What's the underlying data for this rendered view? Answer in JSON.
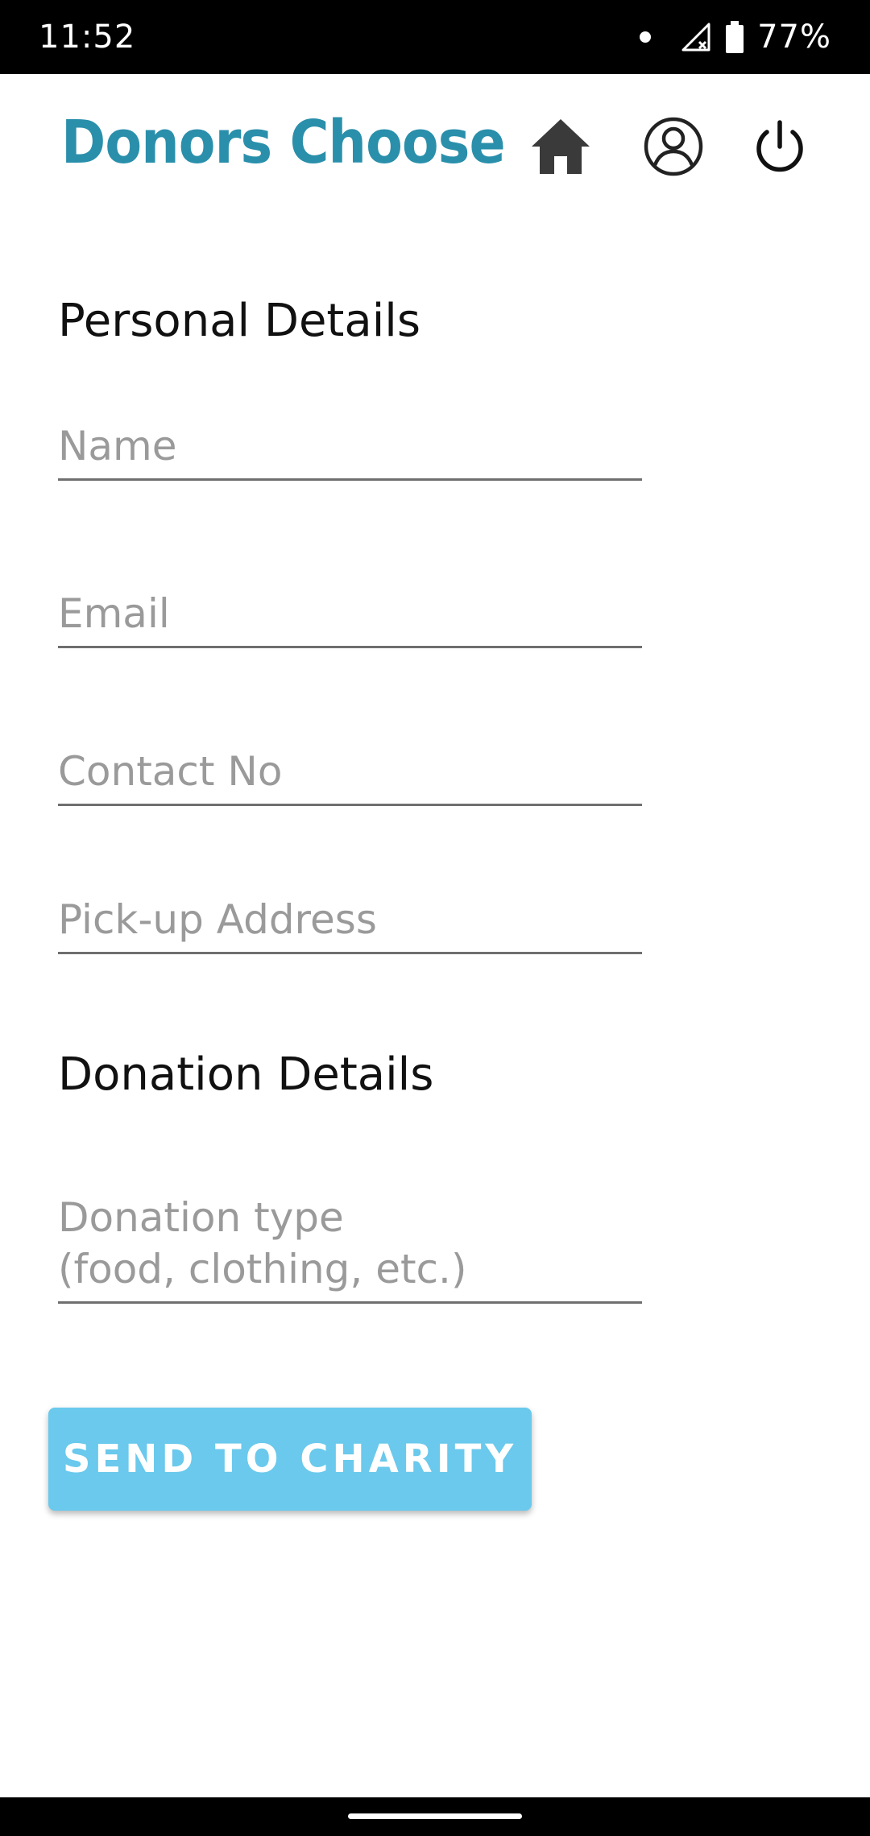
{
  "status_bar": {
    "time": "11:52",
    "battery": "77%",
    "icons": [
      "notification-dot",
      "signal-no-data-icon",
      "battery-icon"
    ]
  },
  "header": {
    "title": "Donors Choose",
    "title_color": "#2a8fab",
    "icons": [
      "home-icon",
      "profile-icon",
      "power-icon"
    ]
  },
  "form": {
    "personal_heading": "Personal Details",
    "name_placeholder": "Name",
    "email_placeholder": "Email",
    "contact_placeholder": "Contact No",
    "address_placeholder": "Pick-up Address",
    "donation_heading": "Donation Details",
    "donation_type_placeholder": "Donation type\n(food, clothing, etc.)"
  },
  "actions": {
    "send_label": "SEND TO CHARITY",
    "send_color": "#6ac9ec"
  }
}
